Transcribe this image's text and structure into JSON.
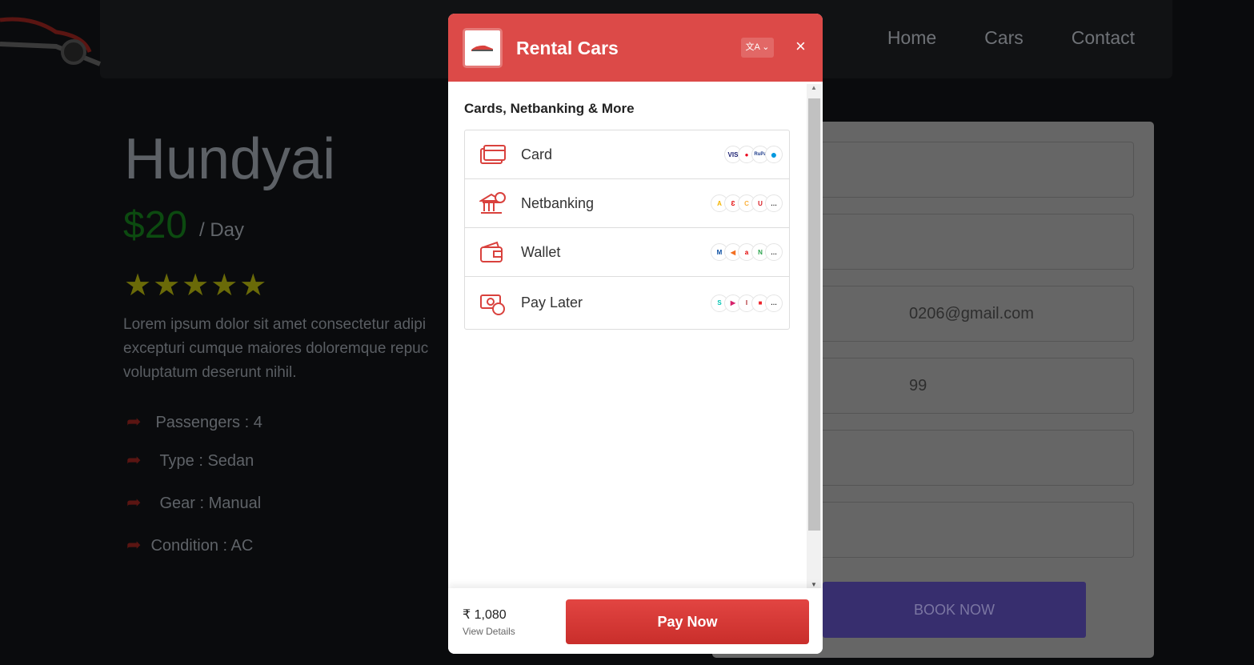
{
  "nav": {
    "links": [
      "Home",
      "Cars",
      "Contact"
    ]
  },
  "car": {
    "name": "Hundyai",
    "price": "$20",
    "per": "/ Day",
    "stars": "★★★★★",
    "rating": 5,
    "description": [
      "Lorem ipsum dolor sit amet consectetur adipi",
      "excepturi cumque maiores doloremque repuc",
      "voluptatum deserunt nihil."
    ],
    "features": [
      "Passengers : 4",
      "Type : Sedan",
      "Gear : Manual",
      "Condition : AC"
    ]
  },
  "form": {
    "email": "0206@gmail.com",
    "phone": "99",
    "book_label": "BOOK NOW"
  },
  "modal": {
    "title": "Rental Cars",
    "lang_icon": "translate-icon",
    "close": "×",
    "section": "Cards, Netbanking & More",
    "methods": [
      {
        "label": "Card",
        "icon": "card-icon",
        "logos": [
          "VISA",
          "MC",
          "RuPay",
          "Maestro"
        ]
      },
      {
        "label": "Netbanking",
        "icon": "bank-icon",
        "logos": [
          "Axis",
          "Airtel",
          "Canara",
          "Union",
          "…"
        ]
      },
      {
        "label": "Wallet",
        "icon": "wallet-icon",
        "logos": [
          "Mobikwik",
          "Freecharge",
          "Airtel",
          "N",
          "…"
        ]
      },
      {
        "label": "Pay Later",
        "icon": "paylater-icon",
        "logos": [
          "Simpl",
          "LazyPay",
          "ICICI",
          "HDFC",
          "…"
        ]
      }
    ],
    "amount": "₹ 1,080",
    "view_details": "View Details",
    "pay_label": "Pay Now"
  },
  "colors": {
    "brand": "#dc4a48",
    "book": "#372e6e"
  }
}
